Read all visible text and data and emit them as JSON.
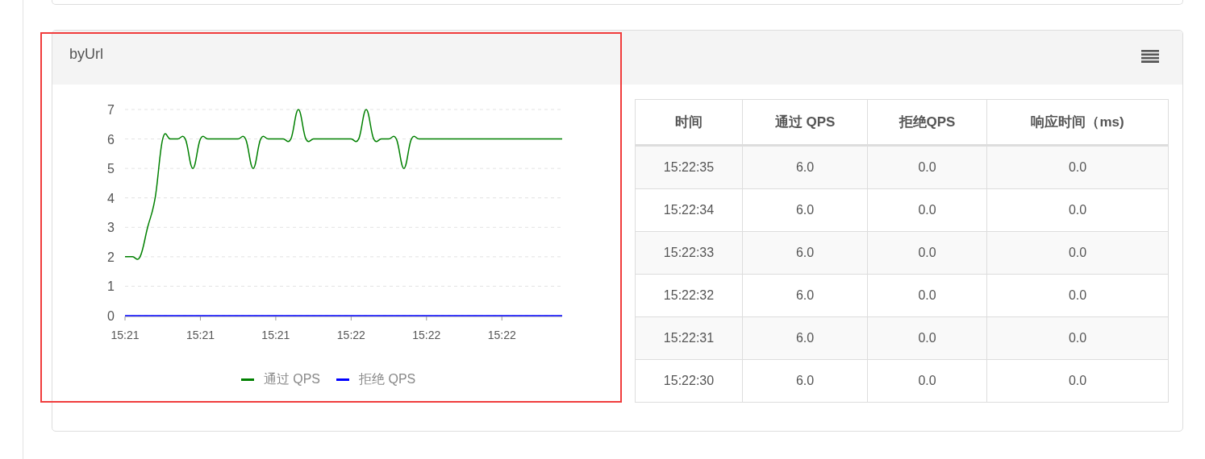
{
  "panel": {
    "title": "byUrl",
    "chart_data": {
      "type": "line",
      "categories": [
        "15:21",
        null,
        null,
        null,
        null,
        null,
        null,
        null,
        null,
        null,
        "15:21",
        null,
        null,
        null,
        null,
        null,
        null,
        null,
        null,
        null,
        "15:21",
        null,
        null,
        null,
        null,
        null,
        null,
        null,
        null,
        null,
        "15:22",
        null,
        null,
        null,
        null,
        null,
        null,
        null,
        null,
        null,
        "15:22",
        null,
        null,
        null,
        null,
        null,
        null,
        null,
        null,
        null,
        "15:22",
        null,
        null,
        null,
        null,
        null,
        null,
        null,
        null
      ],
      "series": [
        {
          "name": "通过 QPS",
          "color": "#008000",
          "values": [
            2,
            2,
            2,
            3,
            4,
            6,
            6,
            6,
            6,
            5,
            6,
            6,
            6,
            6,
            6,
            6,
            6,
            5,
            6,
            6,
            6,
            6,
            6,
            7,
            6,
            6,
            6,
            6,
            6,
            6,
            6,
            6,
            7,
            6,
            6,
            6,
            6,
            5,
            6,
            6,
            6,
            6,
            6,
            6,
            6,
            6,
            6,
            6,
            6,
            6,
            6,
            6,
            6,
            6,
            6,
            6,
            6,
            6,
            6
          ]
        },
        {
          "name": "拒绝 QPS",
          "color": "#0000ff",
          "values": [
            0,
            0,
            0,
            0,
            0,
            0,
            0,
            0,
            0,
            0,
            0,
            0,
            0,
            0,
            0,
            0,
            0,
            0,
            0,
            0,
            0,
            0,
            0,
            0,
            0,
            0,
            0,
            0,
            0,
            0,
            0,
            0,
            0,
            0,
            0,
            0,
            0,
            0,
            0,
            0,
            0,
            0,
            0,
            0,
            0,
            0,
            0,
            0,
            0,
            0,
            0,
            0,
            0,
            0,
            0,
            0,
            0,
            0,
            0
          ]
        }
      ],
      "ylim": [
        0,
        7
      ],
      "yticks": [
        0,
        1,
        2,
        3,
        4,
        5,
        6,
        7
      ],
      "grid": true,
      "legend": "bottom"
    }
  },
  "table": {
    "columns": [
      "时间",
      "通过 QPS",
      "拒绝QPS",
      "响应时间（ms)"
    ],
    "rows": [
      [
        "15:22:35",
        "6.0",
        "0.0",
        "0.0"
      ],
      [
        "15:22:34",
        "6.0",
        "0.0",
        "0.0"
      ],
      [
        "15:22:33",
        "6.0",
        "0.0",
        "0.0"
      ],
      [
        "15:22:32",
        "6.0",
        "0.0",
        "0.0"
      ],
      [
        "15:22:31",
        "6.0",
        "0.0",
        "0.0"
      ],
      [
        "15:22:30",
        "6.0",
        "0.0",
        "0.0"
      ]
    ]
  }
}
